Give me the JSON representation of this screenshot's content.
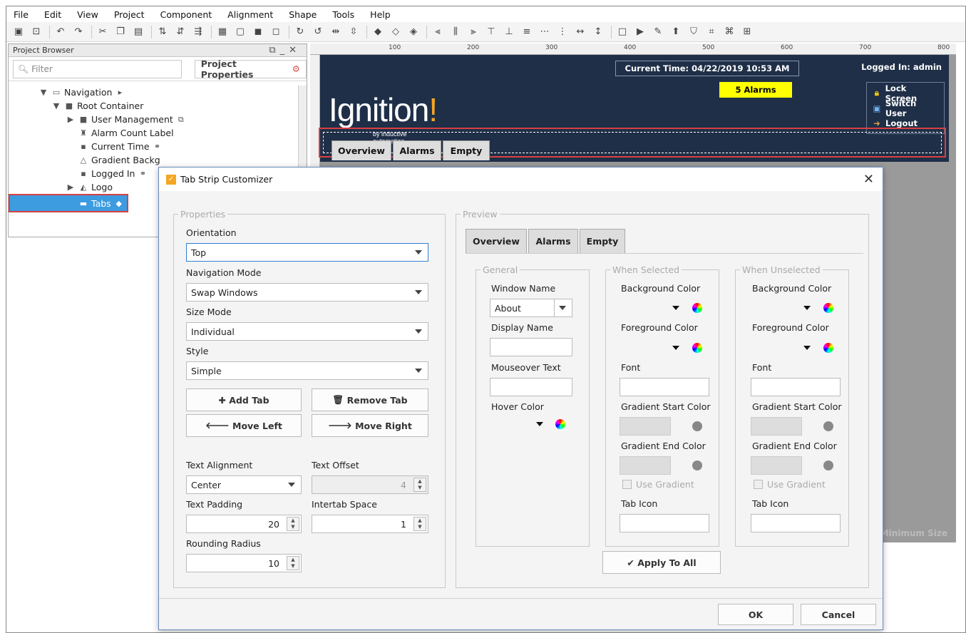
{
  "menu": [
    "File",
    "Edit",
    "View",
    "Project",
    "Component",
    "Alignment",
    "Shape",
    "Tools",
    "Help"
  ],
  "project_browser": {
    "title": "Project Browser",
    "filter_placeholder": "Filter",
    "properties_button": "Project Properties",
    "tree": [
      {
        "label": "Navigation",
        "depth": 2
      },
      {
        "label": "Root Container",
        "depth": 3
      },
      {
        "label": "User Management",
        "depth": 4
      },
      {
        "label": "Alarm Count Label",
        "depth": 4
      },
      {
        "label": "Current Time",
        "depth": 4
      },
      {
        "label": "Gradient Backg",
        "depth": 4
      },
      {
        "label": "Logged In",
        "depth": 4
      },
      {
        "label": "Logo",
        "depth": 4
      },
      {
        "label": "Tabs",
        "depth": 4,
        "selected": true
      }
    ]
  },
  "designer": {
    "ruler_labels": [
      "100",
      "200",
      "300",
      "400",
      "500",
      "600",
      "700",
      "800"
    ],
    "current_time": "Current Time: 04/22/2019 10:53 AM",
    "alarms": "5 Alarms",
    "logged_in": "Logged In: admin",
    "lock_screen": "Lock Screen",
    "switch_user": "Switch User",
    "logout": "Logout",
    "logo_text": "Ignition",
    "logo_bang": "!",
    "logo_sub": "by inductive automation",
    "tabs": [
      "Overview",
      "Alarms",
      "Empty"
    ],
    "min_size": "Minimum Size"
  },
  "dialog": {
    "title": "Tab Strip Customizer",
    "properties_legend": "Properties",
    "orientation_label": "Orientation",
    "orientation_value": "Top",
    "nav_mode_label": "Navigation Mode",
    "nav_mode_value": "Swap Windows",
    "size_mode_label": "Size Mode",
    "size_mode_value": "Individual",
    "style_label": "Style",
    "style_value": "Simple",
    "add_tab": "Add Tab",
    "remove_tab": "Remove Tab",
    "move_left": "Move Left",
    "move_right": "Move Right",
    "text_alignment_label": "Text Alignment",
    "text_alignment_value": "Center",
    "text_offset_label": "Text Offset",
    "text_offset_value": "4",
    "text_padding_label": "Text Padding",
    "text_padding_value": "20",
    "intertab_label": "Intertab Space",
    "intertab_value": "1",
    "rounding_label": "Rounding Radius",
    "rounding_value": "10",
    "preview_legend": "Preview",
    "preview_tabs": [
      "Overview",
      "Alarms",
      "Empty"
    ],
    "general_legend": "General",
    "window_name_label": "Window Name",
    "window_name_value": "About",
    "display_name_label": "Display Name",
    "mouseover_label": "Mouseover Text",
    "hover_color_label": "Hover Color",
    "selected_legend": "When Selected",
    "unselected_legend": "When Unselected",
    "bg_color_label": "Background Color",
    "fg_color_label": "Foreground Color",
    "font_label": "Font",
    "grad_start_label": "Gradient Start Color",
    "grad_end_label": "Gradient End Color",
    "use_gradient_label": "Use Gradient",
    "tab_icon_label": "Tab Icon",
    "apply_all": "Apply To All",
    "ok": "OK",
    "cancel": "Cancel"
  },
  "colors": {
    "header_bg": "#1f2f48",
    "alarm_bg": "#ffff00",
    "selection": "#3d9be0",
    "highlight_border": "#d94040"
  }
}
